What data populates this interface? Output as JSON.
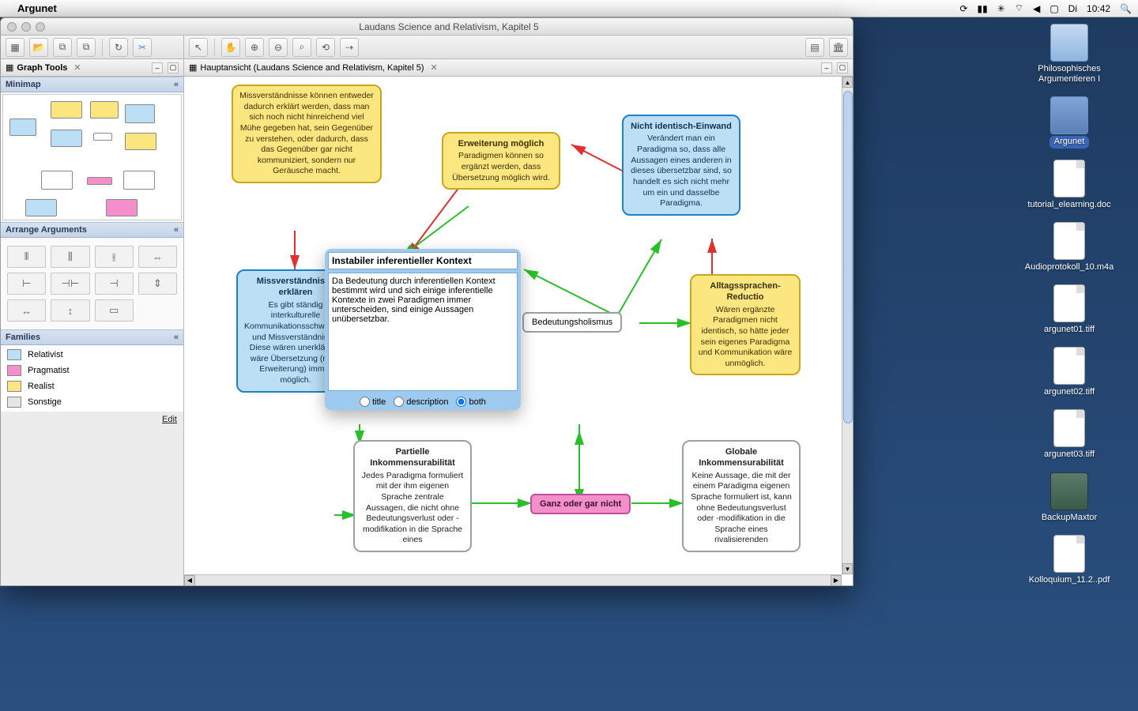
{
  "menubar": {
    "app": "Argunet",
    "day": "Di",
    "time": "10:42"
  },
  "desktop": [
    {
      "label": "Philosophisches Argumentieren I",
      "type": "folder"
    },
    {
      "label": "Argunet",
      "type": "folder",
      "selected": true
    },
    {
      "label": "tutorial_elearning.doc",
      "type": "file"
    },
    {
      "label": "Audioprotokoll_10.m4a",
      "type": "file"
    },
    {
      "label": "argunet01.tiff",
      "type": "file"
    },
    {
      "label": "argunet02.tiff",
      "type": "file"
    },
    {
      "label": "argunet03.tiff",
      "type": "file"
    },
    {
      "label": "BackupMaxtor",
      "type": "drive"
    },
    {
      "label": "Kolloquium_11.2..pdf",
      "type": "file"
    }
  ],
  "window": {
    "title": "Laudans Science and Relativism, Kapitel 5"
  },
  "left": {
    "tab": "Graph Tools",
    "sections": {
      "minimap": "Minimap",
      "arrange": "Arrange Arguments",
      "families": "Families"
    },
    "families": [
      {
        "name": "Relativist",
        "color": "#bcdff6"
      },
      {
        "name": "Pragmatist",
        "color": "#f48fcc"
      },
      {
        "name": "Realist",
        "color": "#fce680"
      },
      {
        "name": "Sonstige",
        "color": "#e6e6e6"
      }
    ],
    "edit": "Edit"
  },
  "main": {
    "tab": "Hauptansicht (Laudans Science and Relativism, Kapitel 5)"
  },
  "editor": {
    "title_value": "Instabiler inferentieller Kontext",
    "desc_value": "Da Bedeutung durch inferentiellen Kontext bestimmt wird und sich einige inferentielle Kontexte in zwei Paradigmen immer unterscheiden, sind einige Aussagen unübersetzbar.",
    "r_title": "title",
    "r_desc": "description",
    "r_both": "both"
  },
  "nodes": {
    "n1_title": "",
    "n1_body": "Missverständnisse können entweder dadurch erklärt werden, dass man sich noch nicht hinreichend viel Mühe gegeben hat, sein Gegenüber zu verstehen, oder dadurch, dass das Gegenüber gar nicht kommuniziert, sondern nur Geräusche macht.",
    "n2_title": "Erweiterung möglich",
    "n2_body": "Paradigmen können so ergänzt werden, dass Übersetzung möglich wird.",
    "n3_title": "Nicht identisch-Einwand",
    "n3_body": "Verändert man ein Paradigma so, dass alle Aussagen eines anderen in dieses übersetzbar sind, so handelt es sich nicht mehr um ein und dasselbe Paradigma.",
    "n4_title": "Missverständnisse erklären",
    "n4_body": "Es gibt ständig interkulturelle Kommunikationsschwierigkeiten und Missverständnisse. Diese wären unerklärbar, wäre Übersetzung (nach Erweiterung) immer möglich.",
    "n5_label": "Bedeutungsholismus",
    "n6_title": "Alltagssprachen-Reductio",
    "n6_body": "Wären ergänzte Paradigmen nicht identisch, so hätte jeder sein eigenes Paradigma und Kommunikation wäre unmöglich.",
    "n7_title": "Partielle Inkommensurabilität",
    "n7_body": "Jedes Paradigma formuliert mit der ihm eigenen Sprache zentrale Aussagen, die nicht ohne Bedeutungsverlust oder -modifikation in die Sprache eines",
    "n8_label": "Ganz oder gar nicht",
    "n9_title": "Globale Inkommensurabilität",
    "n9_body": "Keine Aussage, die mit der einem Paradigma eigenen Sprache formuliert ist, kann ohne Bedeutungsverlust oder -modifikation in die Sprache eines rivalisierenden"
  },
  "colors": {
    "attack": "#e03030",
    "support": "#28c028"
  }
}
